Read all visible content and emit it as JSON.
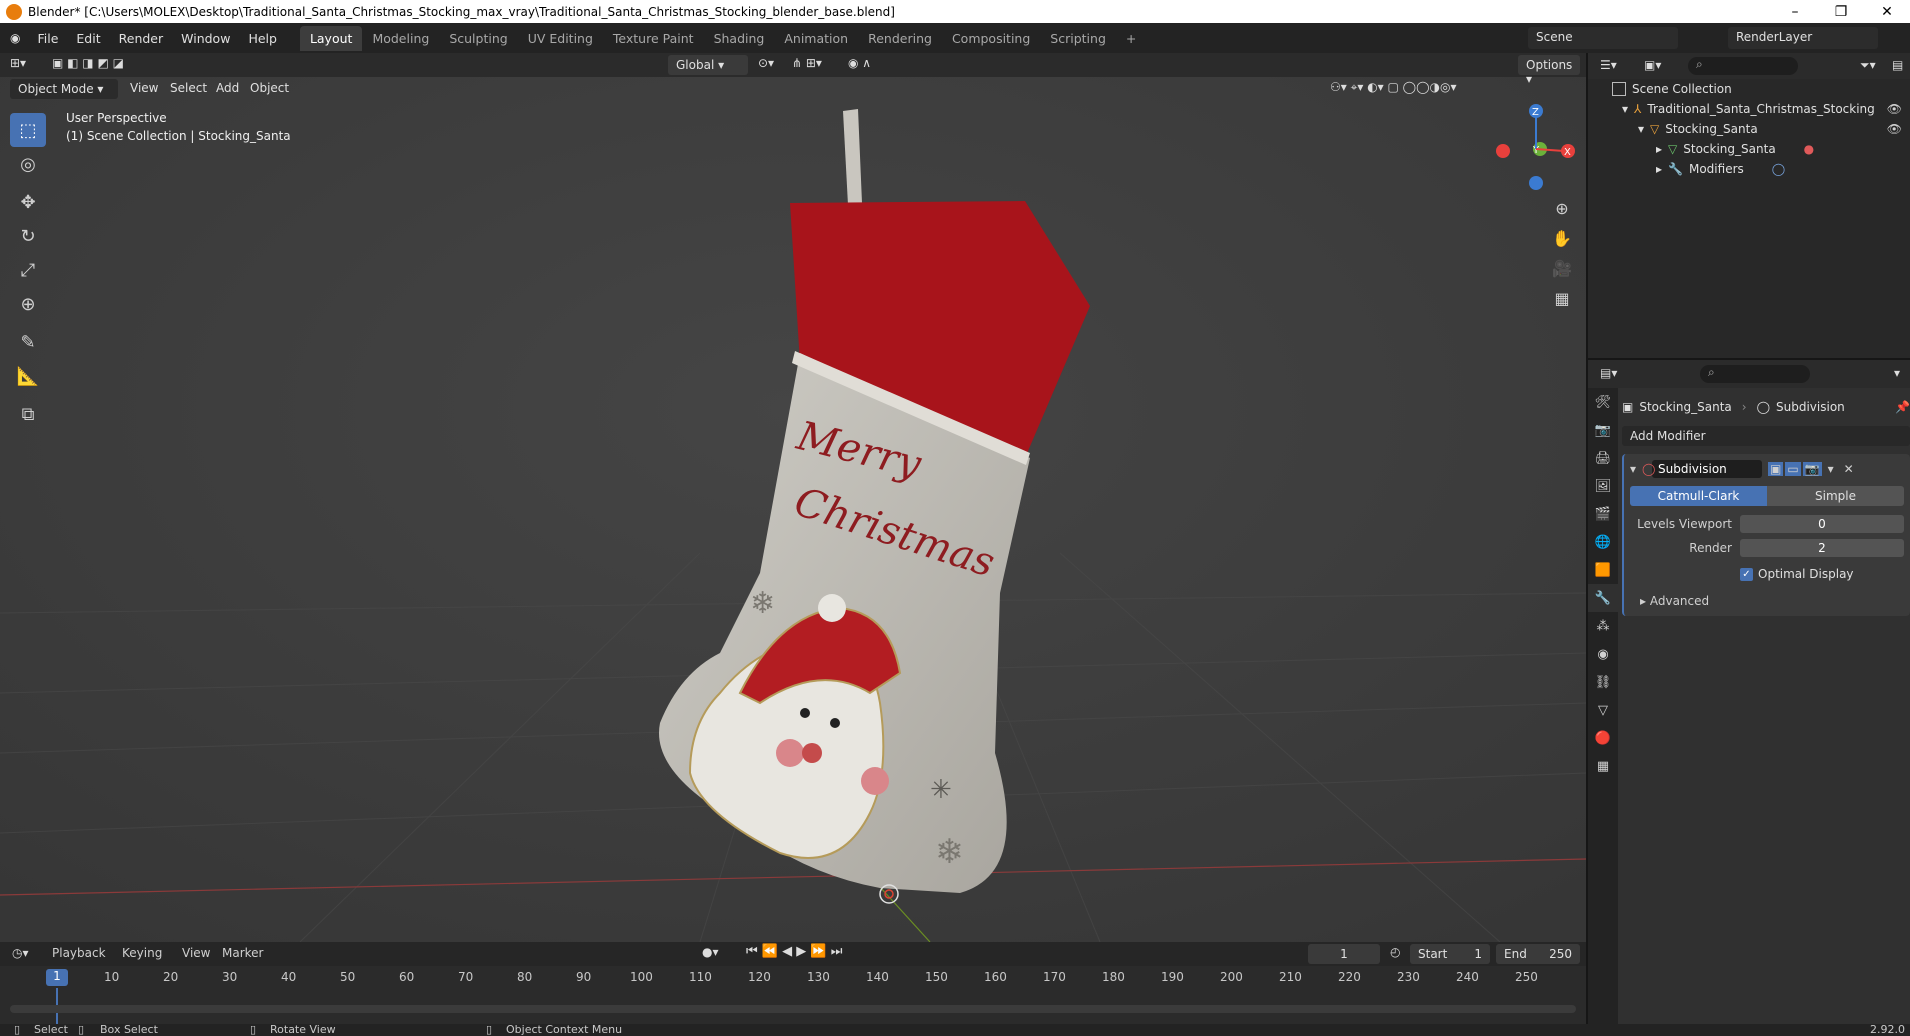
{
  "window": {
    "title": "Blender* [C:\\Users\\MOLEX\\Desktop\\Traditional_Santa_Christmas_Stocking_max_vray\\Traditional_Santa_Christmas_Stocking_blender_base.blend]"
  },
  "menubar": {
    "items": [
      "File",
      "Edit",
      "Render",
      "Window",
      "Help"
    ],
    "workspaces": [
      "Layout",
      "Modeling",
      "Sculpting",
      "UV Editing",
      "Texture Paint",
      "Shading",
      "Animation",
      "Rendering",
      "Compositing",
      "Scripting"
    ],
    "active_workspace": "Layout",
    "add_tab": "+",
    "scene": "Scene",
    "render_layer": "RenderLayer"
  },
  "viewport": {
    "transform_orientation": "Global",
    "options_label": "Options",
    "mode": "Object Mode",
    "menus": [
      "View",
      "Select",
      "Add",
      "Object"
    ],
    "info_line1": "User Perspective",
    "info_line2": "(1) Scene Collection | Stocking_Santa",
    "stocking_text_line1": "Merry",
    "stocking_text_line2": "Christmas",
    "gizmo_axes": [
      "Z",
      "Y",
      "X"
    ]
  },
  "timeline": {
    "menus": [
      "Playback",
      "Keying",
      "View",
      "Marker"
    ],
    "current_frame": "1",
    "start_label": "Start",
    "start_value": "1",
    "end_label": "End",
    "end_value": "250",
    "ruler": [
      "1",
      "10",
      "20",
      "30",
      "40",
      "50",
      "60",
      "70",
      "80",
      "90",
      "100",
      "110",
      "120",
      "130",
      "140",
      "150",
      "160",
      "170",
      "180",
      "190",
      "200",
      "210",
      "220",
      "230",
      "240",
      "250"
    ]
  },
  "statusbar": {
    "select": "Select",
    "box_select": "Box Select",
    "rotate_view": "Rotate View",
    "context_menu": "Object Context Menu",
    "version": "2.92.0"
  },
  "outliner": {
    "scene_collection": "Scene Collection",
    "collection": "Traditional_Santa_Christmas_Stocking",
    "object": "Stocking_Santa",
    "mesh": "Stocking_Santa",
    "modifiers": "Modifiers"
  },
  "properties": {
    "object_name": "Stocking_Santa",
    "modifier_crumb": "Subdivision",
    "add_modifier": "Add Modifier",
    "modifier": {
      "name": "Subdivision",
      "type_on": "Catmull-Clark",
      "type_off": "Simple",
      "levels_viewport_label": "Levels Viewport",
      "levels_viewport_value": "0",
      "render_label": "Render",
      "render_value": "2",
      "optimal_display_label": "Optimal Display",
      "advanced_label": "Advanced"
    }
  }
}
